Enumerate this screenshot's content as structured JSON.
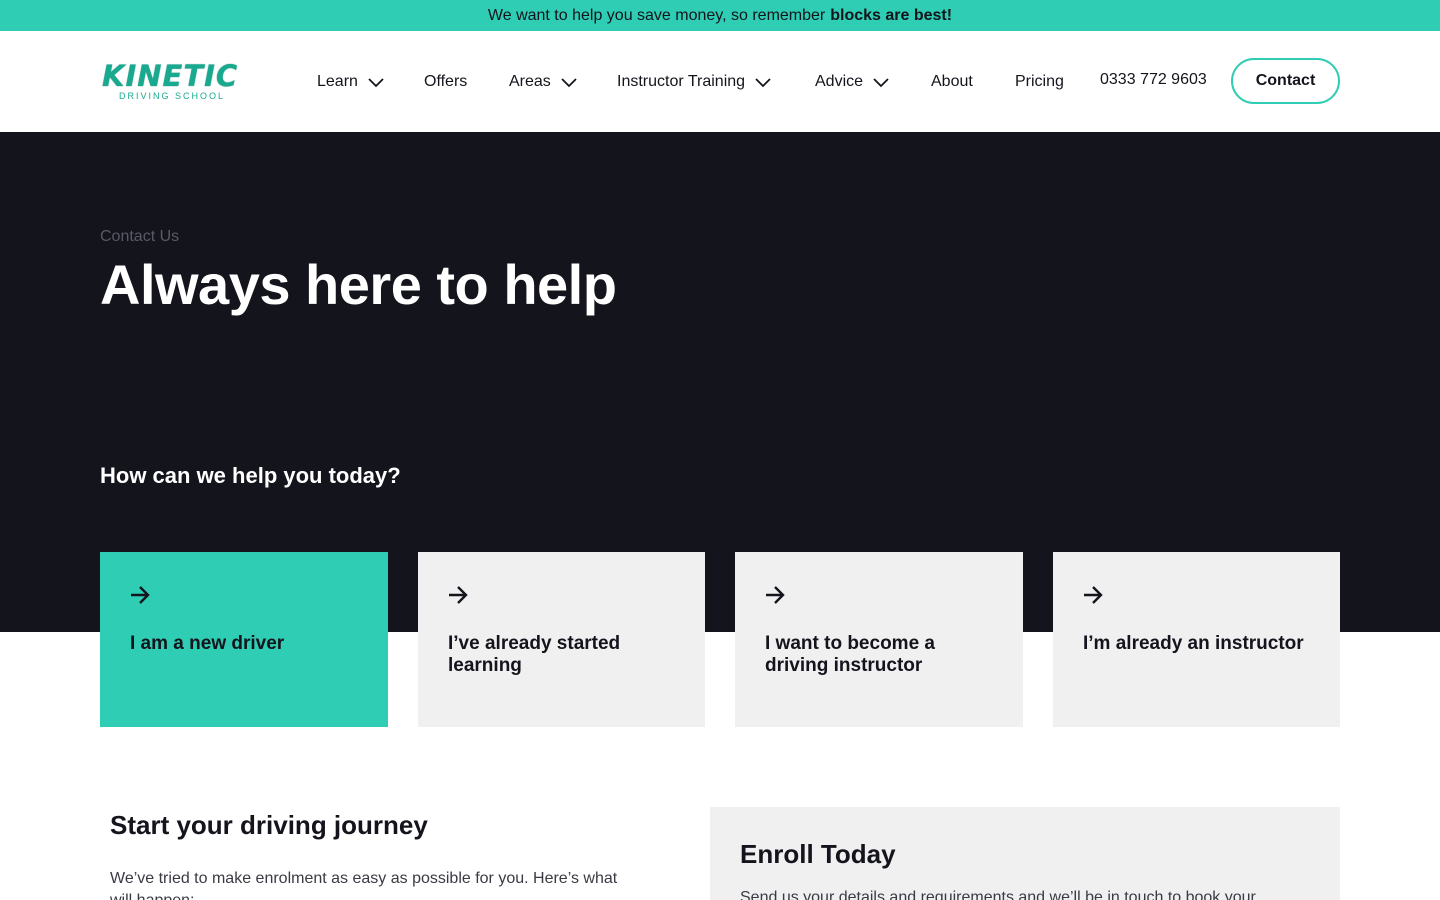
{
  "banner": {
    "text": "We want to help you save money, so remember",
    "bold": "blocks are best!"
  },
  "logo": {
    "main": "KINETIC",
    "sub": "DRIVING SCHOOL"
  },
  "nav": {
    "learn": "Learn",
    "offers": "Offers",
    "areas": "Areas",
    "instructor_training": "Instructor Training",
    "advice": "Advice",
    "about": "About",
    "pricing": "Pricing",
    "phone": "0333 772 9603",
    "contact": "Contact"
  },
  "hero": {
    "eyebrow": "Contact Us",
    "title": "Always here to help",
    "question": "How can we help you today?"
  },
  "cards": [
    {
      "label": "I am a new driver",
      "icon": "arrow-right-icon"
    },
    {
      "label": "I’ve already started learning",
      "icon": "arrow-right-icon"
    },
    {
      "label": "I want to become a driving instructor",
      "icon": "arrow-right-icon"
    },
    {
      "label": "I’m already an instructor",
      "icon": "arrow-right-icon"
    }
  ],
  "journey": {
    "title": "Start your driving journey",
    "text": "We’ve tried to make enrolment as easy as possible for you. Here’s what will happen:"
  },
  "enroll": {
    "title": "Enroll Today",
    "text": "Send us your details and requirements and we’ll be in touch to book your"
  },
  "colors": {
    "accent": "#2ecdb4",
    "dark": "#14141c",
    "card": "#f0f0f1",
    "logo": "#19a98f"
  }
}
